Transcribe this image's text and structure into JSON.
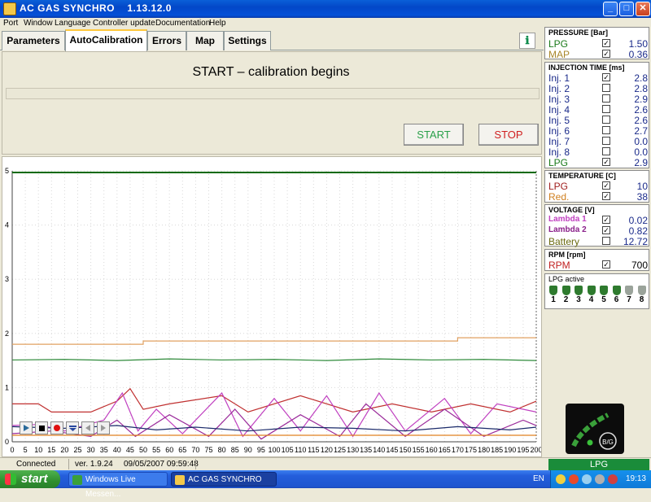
{
  "window": {
    "app_title": "AC GAS SYNCHRO",
    "version": "1.13.12.0",
    "min": "_",
    "max": "□",
    "close": "✕"
  },
  "menu": [
    "Port",
    "Window",
    "Language",
    "Controller update",
    "Documentation",
    "Help"
  ],
  "tabs": [
    "Parameters",
    "AutoCalibration",
    "Errors",
    "Map",
    "Settings"
  ],
  "active_tab": "AutoCalibration",
  "main": {
    "status_title": "START – calibration begins",
    "start_label": "START",
    "stop_label": "STOP"
  },
  "chart_data": {
    "type": "line",
    "y_ticks": [
      "0",
      "1",
      "2",
      "3",
      "4",
      "5"
    ],
    "x_ticks": [
      "0",
      "5",
      "10",
      "15",
      "20",
      "25",
      "30",
      "35",
      "40",
      "45",
      "50",
      "55",
      "60",
      "65",
      "70",
      "75",
      "80",
      "85",
      "90",
      "95",
      "100",
      "105",
      "110",
      "115",
      "120",
      "125",
      "130",
      "135",
      "140",
      "145",
      "150",
      "155",
      "160",
      "165",
      "170",
      "175",
      "180",
      "185",
      "190",
      "195",
      "200"
    ],
    "ylim": [
      0,
      5
    ],
    "xlim": [
      0,
      200
    ],
    "series": [
      {
        "color": "#0a6a0a",
        "values": [
          [
            0,
            4.97
          ],
          [
            200,
            4.97
          ]
        ]
      },
      {
        "color": "#e0a060",
        "values": [
          [
            0,
            1.8
          ],
          [
            50,
            1.8
          ],
          [
            50,
            1.86
          ],
          [
            170,
            1.86
          ],
          [
            170,
            1.92
          ],
          [
            200,
            1.92
          ]
        ]
      },
      {
        "color": "#2e8a3a",
        "values": [
          [
            0,
            1.51
          ],
          [
            20,
            1.52
          ],
          [
            40,
            1.5
          ],
          [
            60,
            1.53
          ],
          [
            80,
            1.51
          ],
          [
            100,
            1.52
          ],
          [
            120,
            1.5
          ],
          [
            140,
            1.53
          ],
          [
            160,
            1.51
          ],
          [
            180,
            1.52
          ],
          [
            200,
            1.5
          ]
        ]
      },
      {
        "color": "#c03030",
        "values": [
          [
            0,
            0.7
          ],
          [
            10,
            0.7
          ],
          [
            15,
            0.55
          ],
          [
            30,
            0.55
          ],
          [
            40,
            0.75
          ],
          [
            45,
            0.98
          ],
          [
            50,
            0.6
          ],
          [
            60,
            0.7
          ],
          [
            80,
            0.85
          ],
          [
            90,
            0.55
          ],
          [
            110,
            0.85
          ],
          [
            130,
            0.55
          ],
          [
            145,
            0.7
          ],
          [
            160,
            0.55
          ],
          [
            175,
            0.7
          ],
          [
            190,
            0.55
          ],
          [
            200,
            0.75
          ]
        ]
      },
      {
        "color": "#c040c0",
        "values": [
          [
            0,
            0.3
          ],
          [
            10,
            0.32
          ],
          [
            20,
            0.2
          ],
          [
            35,
            0.4
          ],
          [
            42,
            0.9
          ],
          [
            48,
            0.2
          ],
          [
            55,
            0.6
          ],
          [
            65,
            0.15
          ],
          [
            80,
            0.9
          ],
          [
            88,
            0.1
          ],
          [
            100,
            0.8
          ],
          [
            110,
            0.2
          ],
          [
            120,
            0.85
          ],
          [
            130,
            0.1
          ],
          [
            140,
            0.9
          ],
          [
            150,
            0.2
          ],
          [
            165,
            0.8
          ],
          [
            175,
            0.15
          ],
          [
            185,
            0.7
          ],
          [
            200,
            0.55
          ]
        ]
      },
      {
        "color": "#9a2a9a",
        "values": [
          [
            0,
            0.15
          ],
          [
            15,
            0.2
          ],
          [
            30,
            0.1
          ],
          [
            40,
            0.4
          ],
          [
            47,
            0.1
          ],
          [
            60,
            0.5
          ],
          [
            75,
            0.1
          ],
          [
            85,
            0.6
          ],
          [
            95,
            0.05
          ],
          [
            110,
            0.5
          ],
          [
            125,
            0.1
          ],
          [
            135,
            0.7
          ],
          [
            150,
            0.1
          ],
          [
            165,
            0.6
          ],
          [
            180,
            0.1
          ],
          [
            195,
            0.4
          ],
          [
            200,
            0.3
          ]
        ]
      },
      {
        "color": "#1a2a6a",
        "values": [
          [
            0,
            0.28
          ],
          [
            20,
            0.25
          ],
          [
            40,
            0.3
          ],
          [
            55,
            0.22
          ],
          [
            70,
            0.27
          ],
          [
            90,
            0.2
          ],
          [
            110,
            0.27
          ],
          [
            130,
            0.25
          ],
          [
            150,
            0.2
          ],
          [
            170,
            0.28
          ],
          [
            190,
            0.22
          ],
          [
            200,
            0.27
          ]
        ]
      },
      {
        "color": "#e08020",
        "values": [
          [
            0,
            0.12
          ],
          [
            200,
            0.12
          ]
        ]
      }
    ]
  },
  "panel": {
    "pressure": {
      "title": "PRESSURE [Bar]",
      "rows": [
        {
          "label": "LPG",
          "checked": "✓",
          "value": "1.50",
          "color": "#1a7a1a"
        },
        {
          "label": "MAP",
          "checked": "✓",
          "value": "0.36",
          "color": "#a8862a"
        }
      ]
    },
    "injection": {
      "title": "INJECTION TIME [ms]",
      "rows": [
        {
          "label": "Inj. 1",
          "checked": "✓",
          "value": "2.8",
          "color": "#1a2a8a"
        },
        {
          "label": "Inj. 2",
          "checked": "",
          "value": "2.8",
          "color": "#1a2a8a"
        },
        {
          "label": "Inj. 3",
          "checked": "",
          "value": "2.9",
          "color": "#1a2a8a"
        },
        {
          "label": "Inj. 4",
          "checked": "",
          "value": "2.6",
          "color": "#1a2a8a"
        },
        {
          "label": "Inj. 5",
          "checked": "",
          "value": "2.6",
          "color": "#1a2a8a"
        },
        {
          "label": "Inj. 6",
          "checked": "",
          "value": "2.7",
          "color": "#1a2a8a"
        },
        {
          "label": "Inj. 7",
          "checked": "",
          "value": "0.0",
          "color": "#1a2a8a"
        },
        {
          "label": "Inj. 8",
          "checked": "",
          "value": "0.0",
          "color": "#1a2a8a"
        },
        {
          "label": "LPG",
          "checked": "✓",
          "value": "2.9",
          "color": "#1a7a1a"
        }
      ]
    },
    "temperature": {
      "title": "TEMPERATURE [C]",
      "rows": [
        {
          "label": "LPG",
          "checked": "✓",
          "value": "10",
          "color": "#a02020"
        },
        {
          "label": "Red.",
          "checked": "✓",
          "value": "38",
          "color": "#d08020"
        }
      ]
    },
    "voltage": {
      "title": "VOLTAGE [V]",
      "rows": [
        {
          "label": "Lambda 1",
          "checked": "✓",
          "value": "0.02",
          "color": "#c040c0"
        },
        {
          "label": "Lambda 2",
          "checked": "✓",
          "value": "0.82",
          "color": "#8a208a"
        },
        {
          "label": "Battery",
          "checked": "",
          "value": "12.72",
          "color": "#6a6a10"
        }
      ]
    },
    "rpm": {
      "title": "RPM [rpm]",
      "rows": [
        {
          "label": "RPM",
          "checked": "✓",
          "value": "700",
          "color": "#c02020"
        }
      ]
    },
    "lpg_active": {
      "title": "LPG active",
      "injectors": [
        "1",
        "2",
        "3",
        "4",
        "5",
        "6",
        "7",
        "8"
      ],
      "active": [
        true,
        true,
        true,
        true,
        true,
        true,
        false,
        false
      ]
    }
  },
  "statusbar": {
    "connection": "Connected",
    "version": "ver. 1.9.24",
    "datetime": "09/05/2007  09:59:48",
    "fuel": "LPG"
  },
  "badge": {
    "label": "B/G"
  },
  "taskbar": {
    "start": "start",
    "tasks": [
      "Windows Live Messen...",
      "AC GAS SYNCHRO"
    ],
    "lang": "EN",
    "clock": "19:13"
  }
}
